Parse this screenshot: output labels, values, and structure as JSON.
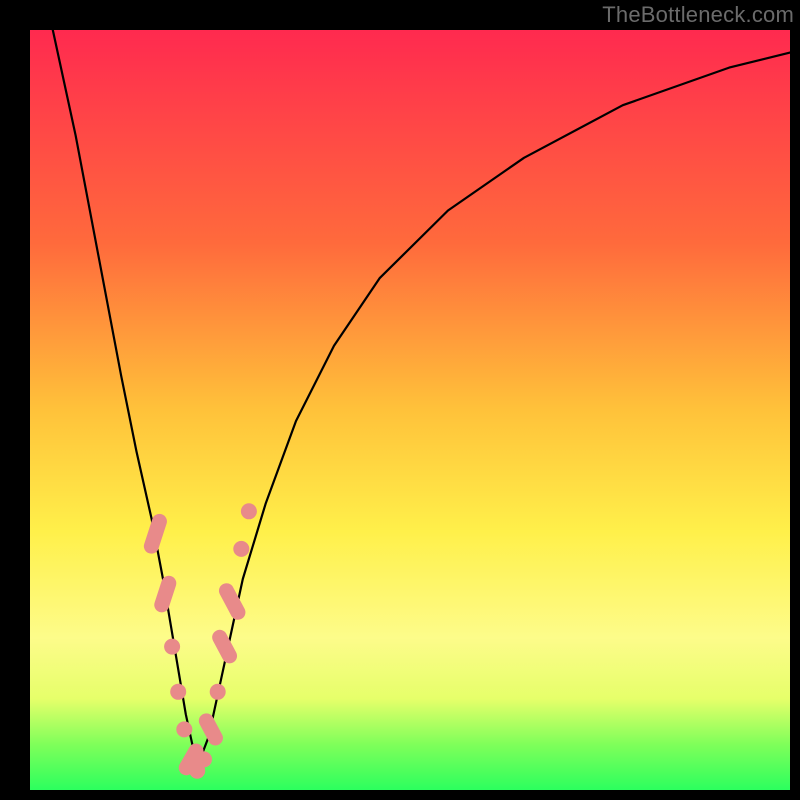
{
  "watermark": "TheBottleneck.com",
  "colors": {
    "gradient_top": "#ff2a4f",
    "gradient_mid_orange": "#ff6a3c",
    "gradient_mid_yellow": "#ffc23a",
    "gradient_light_yellow": "#fff04a",
    "gradient_band": "#fdfc8a",
    "gradient_green": "#2cff5e",
    "curve": "#000000",
    "marker": "#e88a8a",
    "frame": "#000000"
  },
  "chart_data": {
    "type": "line",
    "title": "",
    "xlabel": "",
    "ylabel": "",
    "xlim": [
      0,
      100
    ],
    "ylim": [
      0,
      100
    ],
    "note": "No tick labels or units are shown; x/y normalized 0–100. y≈100 at top, y≈0 at green band. V-shaped bottleneck curve with minimum near x≈22.",
    "series": [
      {
        "name": "bottleneck-curve",
        "x": [
          3,
          6,
          9,
          12,
          14,
          16,
          17.5,
          19,
          20.5,
          22,
          23.5,
          25,
          26.5,
          28,
          31,
          35,
          40,
          46,
          55,
          65,
          78,
          92,
          100
        ],
        "y": [
          100,
          86,
          70,
          54,
          44,
          35,
          27,
          18,
          9,
          2,
          6,
          13,
          20,
          27,
          37,
          48,
          58,
          67,
          76,
          83,
          90,
          95,
          97
        ]
      }
    ],
    "markers": {
      "name": "highlighted-points",
      "description": "Salmon pill/dot markers clustered along the lower V of the curve where it crosses the pale/green bands.",
      "points": [
        {
          "x": 16.5,
          "y": 33,
          "shape": "pill",
          "angle": -72,
          "len": 9
        },
        {
          "x": 17.8,
          "y": 25,
          "shape": "pill",
          "angle": -72,
          "len": 7
        },
        {
          "x": 18.7,
          "y": 18,
          "shape": "dot"
        },
        {
          "x": 19.5,
          "y": 12,
          "shape": "dot"
        },
        {
          "x": 20.3,
          "y": 7,
          "shape": "dot"
        },
        {
          "x": 21.2,
          "y": 3,
          "shape": "pill",
          "angle": -60,
          "len": 5
        },
        {
          "x": 22.0,
          "y": 1.5,
          "shape": "dot"
        },
        {
          "x": 22.9,
          "y": 3,
          "shape": "dot"
        },
        {
          "x": 23.8,
          "y": 7,
          "shape": "pill",
          "angle": 62,
          "len": 5
        },
        {
          "x": 24.7,
          "y": 12,
          "shape": "dot"
        },
        {
          "x": 25.6,
          "y": 18,
          "shape": "pill",
          "angle": 62,
          "len": 6
        },
        {
          "x": 26.6,
          "y": 24,
          "shape": "pill",
          "angle": 62,
          "len": 8
        },
        {
          "x": 27.8,
          "y": 31,
          "shape": "dot"
        },
        {
          "x": 28.8,
          "y": 36,
          "shape": "dot"
        }
      ]
    }
  }
}
